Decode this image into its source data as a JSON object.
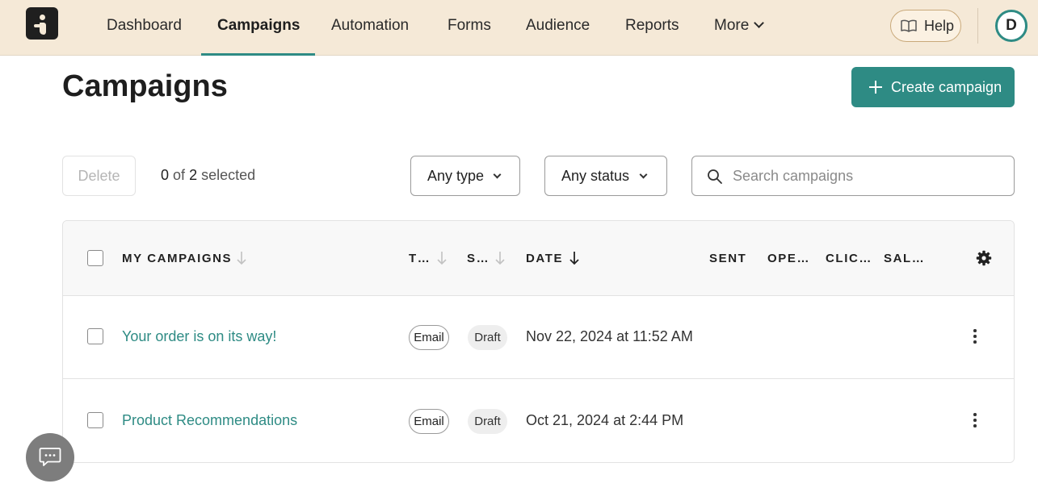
{
  "nav": {
    "items": [
      {
        "label": "Dashboard",
        "name": "nav-dashboard"
      },
      {
        "label": "Campaigns",
        "name": "nav-campaigns",
        "active": true
      },
      {
        "label": "Automation",
        "name": "nav-automation"
      },
      {
        "label": "Forms",
        "name": "nav-forms"
      },
      {
        "label": "Audience",
        "name": "nav-audience"
      },
      {
        "label": "Reports",
        "name": "nav-reports"
      },
      {
        "label": "More",
        "name": "nav-more"
      }
    ],
    "help_label": "Help",
    "avatar_initial": "D"
  },
  "page": {
    "title": "Campaigns",
    "create_label": "Create campaign"
  },
  "toolbar": {
    "delete_label": "Delete",
    "selected_count": "0",
    "selected_total": "2",
    "selected_suffix": "selected",
    "selected_of": "of",
    "type_filter": "Any type",
    "status_filter": "Any status",
    "search_placeholder": "Search campaigns"
  },
  "table": {
    "columns": [
      "MY CAMPAIGNS",
      "T…",
      "S…",
      "DATE",
      "SENT",
      "OPE…",
      "CLIC…",
      "SAL…"
    ],
    "rows": [
      {
        "name": "Your order is on its way!",
        "type": "Email",
        "status": "Draft",
        "date": "Nov 22, 2024 at 11:52 AM"
      },
      {
        "name": "Product Recommendations",
        "type": "Email",
        "status": "Draft",
        "date": "Oct 21, 2024 at 2:44 PM"
      }
    ]
  },
  "icons": {
    "logo": "brand-logo",
    "help": "book-icon",
    "create": "plus-icon",
    "search": "search-icon",
    "settings": "gear-icon",
    "row_menu": "kebab-menu-icon",
    "chat": "chat-icon"
  },
  "colors": {
    "accent": "#2e8b84",
    "nav_bg": "#f5e9d7",
    "chat_bg": "#7d7d7d"
  }
}
